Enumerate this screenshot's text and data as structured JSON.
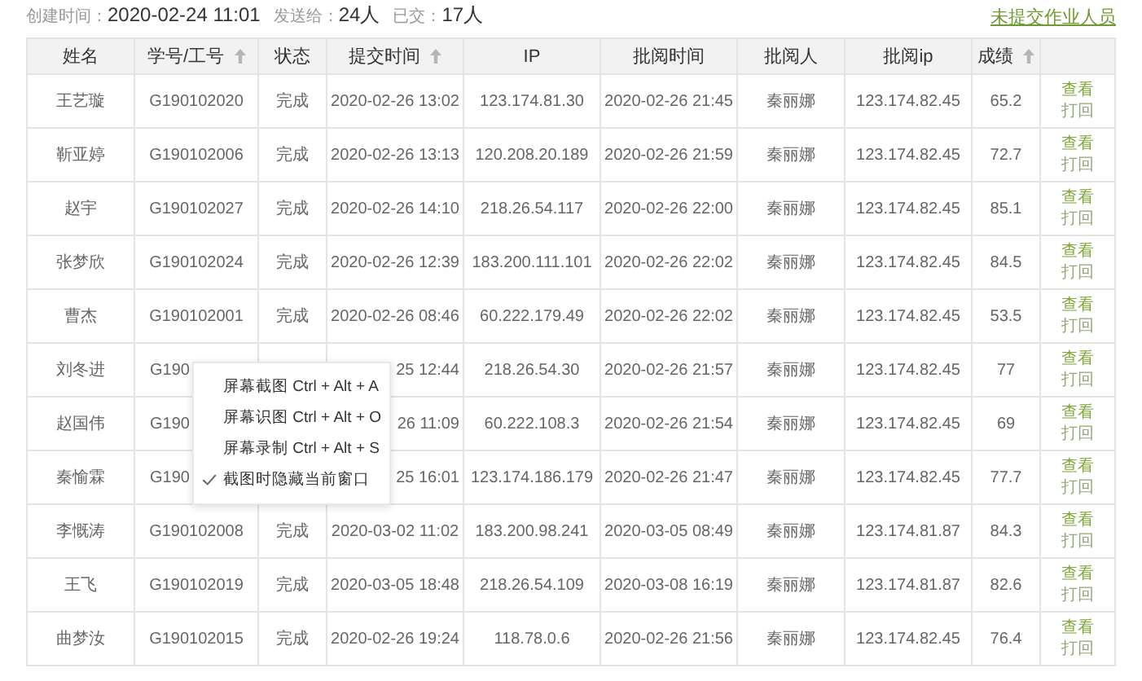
{
  "meta": [
    {
      "label": "创建时间：",
      "value": "2020-02-24 11:01"
    },
    {
      "label": "发送给：",
      "value": "24人"
    },
    {
      "label": "已交：",
      "value": "17人"
    }
  ],
  "missing_link": "未提交作业人员",
  "table": {
    "columns": [
      {
        "label": "姓名",
        "sortable": false
      },
      {
        "label": "学号/工号",
        "sortable": true
      },
      {
        "label": "状态",
        "sortable": false
      },
      {
        "label": "提交时间",
        "sortable": true
      },
      {
        "label": "IP",
        "sortable": false
      },
      {
        "label": "批阅时间",
        "sortable": false
      },
      {
        "label": "批阅人",
        "sortable": false
      },
      {
        "label": "批阅ip",
        "sortable": false
      },
      {
        "label": "成绩",
        "sortable": true
      }
    ],
    "rows": [
      {
        "cells": [
          "王艺璇",
          "G190102020",
          "完成",
          "2020-02-26 13:02",
          "123.174.81.30",
          "2020-02-26 21:45",
          "秦丽娜",
          "123.174.82.45",
          "65.2"
        ],
        "actions": [
          {
            "label": "查看",
            "kind": "view"
          },
          {
            "label": "打回",
            "kind": "return"
          }
        ]
      },
      {
        "cells": [
          "靳亚婷",
          "G190102006",
          "完成",
          "2020-02-26 13:13",
          "120.208.20.189",
          "2020-02-26 21:59",
          "秦丽娜",
          "123.174.82.45",
          "72.7"
        ],
        "actions": [
          {
            "label": "查看",
            "kind": "view"
          },
          {
            "label": "打回",
            "kind": "return"
          }
        ]
      },
      {
        "cells": [
          "赵宇",
          "G190102027",
          "完成",
          "2020-02-26 14:10",
          "218.26.54.117",
          "2020-02-26 22:00",
          "秦丽娜",
          "123.174.82.45",
          "85.1"
        ],
        "actions": [
          {
            "label": "查看",
            "kind": "view"
          },
          {
            "label": "打回",
            "kind": "return"
          }
        ]
      },
      {
        "cells": [
          "张梦欣",
          "G190102024",
          "完成",
          "2020-02-26 12:39",
          "183.200.111.101",
          "2020-02-26 22:02",
          "秦丽娜",
          "123.174.82.45",
          "84.5"
        ],
        "actions": [
          {
            "label": "查看",
            "kind": "view"
          },
          {
            "label": "打回",
            "kind": "return"
          }
        ]
      },
      {
        "cells": [
          "曹杰",
          "G190102001",
          "完成",
          "2020-02-26 08:46",
          "60.222.179.49",
          "2020-02-26 22:02",
          "秦丽娜",
          "123.174.82.45",
          "53.5"
        ],
        "actions": [
          {
            "label": "查看",
            "kind": "view"
          },
          {
            "label": "打回",
            "kind": "return"
          }
        ]
      },
      {
        "cells": [
          "刘冬进",
          "G190",
          null,
          "25 12:44",
          "218.26.54.30",
          "2020-02-26 21:57",
          "秦丽娜",
          "123.174.82.45",
          "77"
        ],
        "actions": [
          {
            "label": "查看",
            "kind": "view"
          },
          {
            "label": "打回",
            "kind": "return"
          }
        ]
      },
      {
        "cells": [
          "赵国伟",
          "G190",
          null,
          "26 11:09",
          "60.222.108.3",
          "2020-02-26 21:54",
          "秦丽娜",
          "123.174.82.45",
          "69"
        ],
        "actions": [
          {
            "label": "查看",
            "kind": "view"
          },
          {
            "label": "打回",
            "kind": "return"
          }
        ]
      },
      {
        "cells": [
          "秦愉霖",
          "G190",
          null,
          "25 16:01",
          "123.174.186.179",
          "2020-02-26 21:47",
          "秦丽娜",
          "123.174.82.45",
          "77.7"
        ],
        "actions": [
          {
            "label": "查看",
            "kind": "view"
          },
          {
            "label": "打回",
            "kind": "return"
          }
        ]
      },
      {
        "cells": [
          "李慨涛",
          "G190102008",
          "完成",
          "2020-03-02 11:02",
          "183.200.98.241",
          "2020-03-05 08:49",
          "秦丽娜",
          "123.174.81.87",
          "84.3"
        ],
        "actions": [
          {
            "label": "查看",
            "kind": "view"
          },
          {
            "label": "打回",
            "kind": "return"
          }
        ]
      },
      {
        "cells": [
          "王飞",
          "G190102019",
          "完成",
          "2020-03-05 18:48",
          "218.26.54.109",
          "2020-03-08 16:19",
          "秦丽娜",
          "123.174.81.87",
          "82.6"
        ],
        "actions": [
          {
            "label": "查看",
            "kind": "view"
          },
          {
            "label": "打回",
            "kind": "return"
          }
        ]
      },
      {
        "cells": [
          "曲梦汝",
          "G190102015",
          "完成",
          "2020-02-26 19:24",
          "118.78.0.6",
          "2020-02-26 21:56",
          "秦丽娜",
          "123.174.82.45",
          "76.4"
        ],
        "actions": [
          {
            "label": "查看",
            "kind": "view"
          },
          {
            "label": "打回",
            "kind": "return"
          }
        ]
      }
    ]
  },
  "context_menu": [
    {
      "label": "屏幕截图 Ctrl + Alt + A",
      "kind": "command"
    },
    {
      "label": "屏幕识图 Ctrl + Alt + O",
      "kind": "command"
    },
    {
      "label": "屏幕录制 Ctrl + Alt + S",
      "kind": "command"
    },
    {
      "label": "截图时隐藏当前窗口",
      "kind": "toggle",
      "checked": true
    }
  ]
}
